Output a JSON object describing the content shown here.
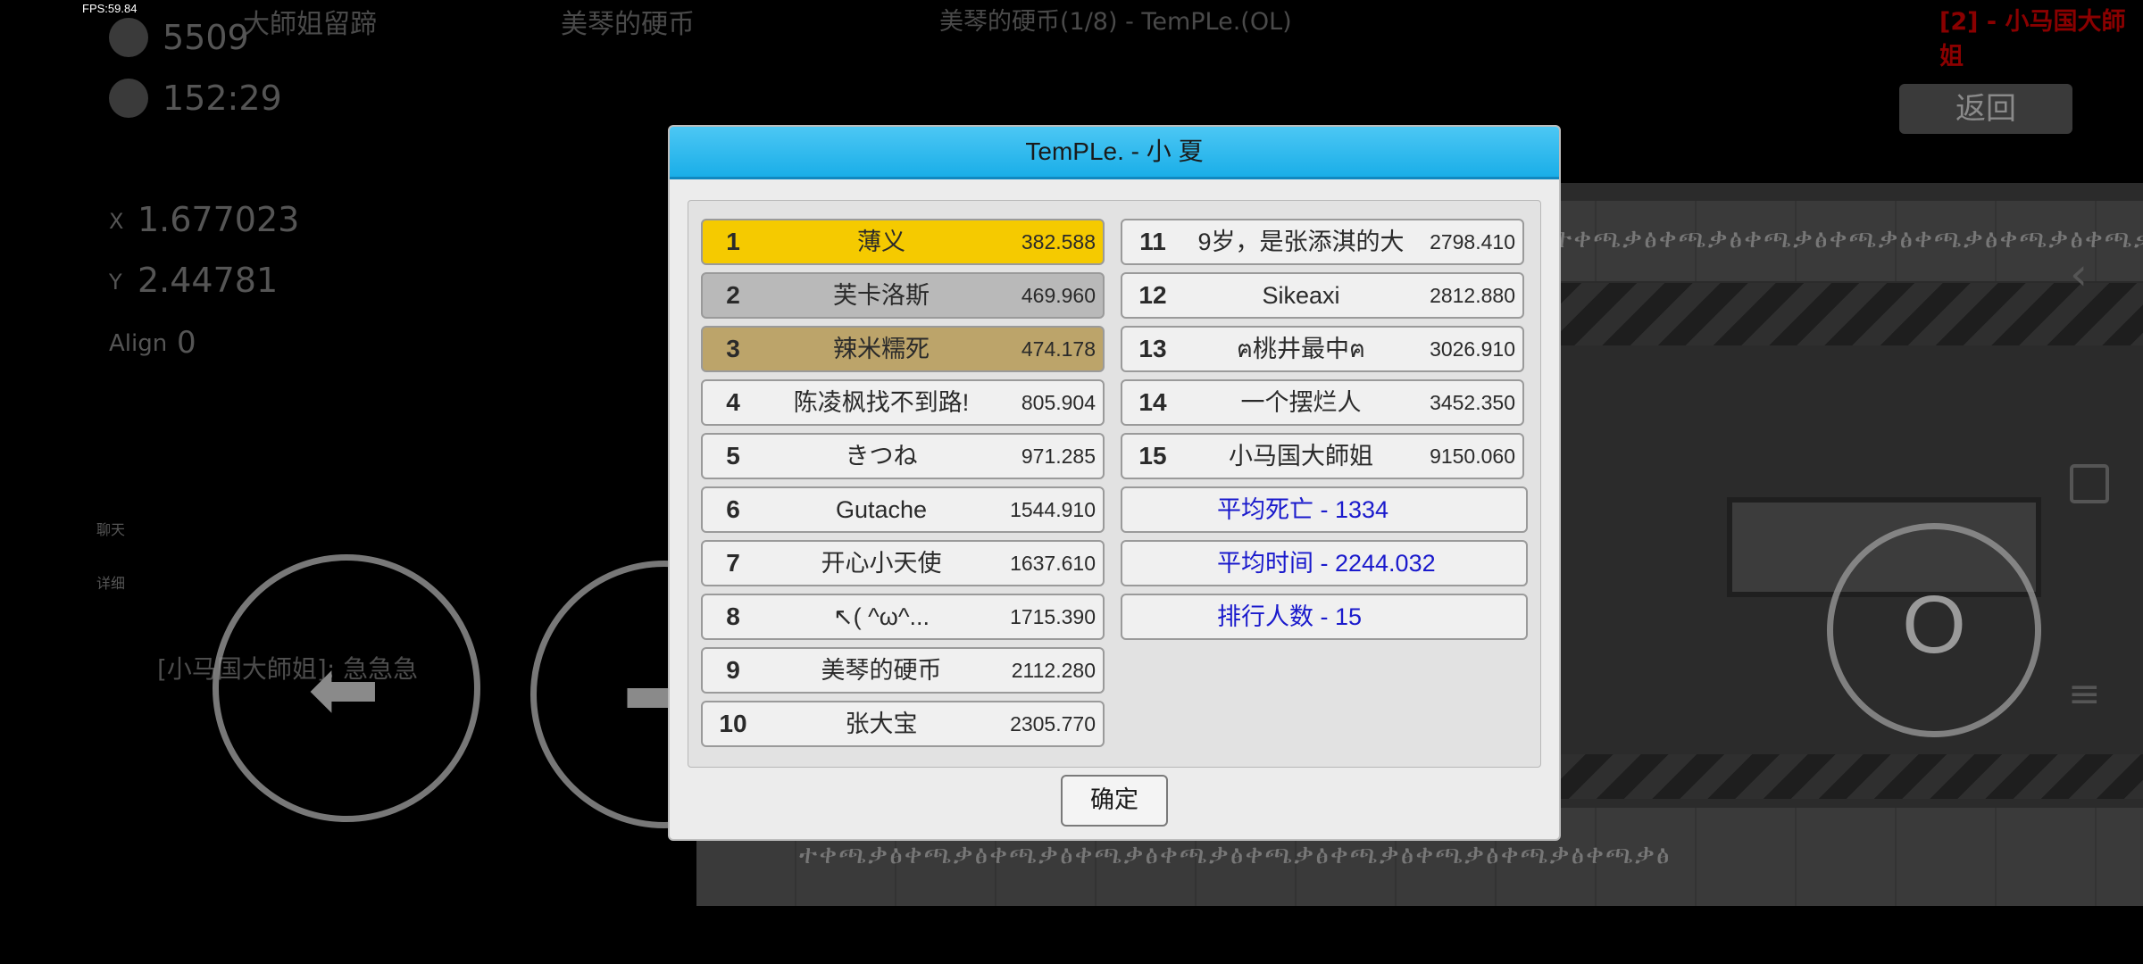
{
  "fps": "FPS:59.84",
  "top_bar": {
    "left_title": "大師姐留蹄",
    "level_name": "美琴的硬币",
    "progress": "美琴的硬币(1/8) - TemPLe.(OL)",
    "player_tag": "[2] - 小马国大師姐"
  },
  "hud": {
    "deaths": "5509",
    "time": "152:29",
    "x_label": "X",
    "x_value": "1.677023",
    "y_label": "Y",
    "y_value": "2.44781",
    "align_label": "Align",
    "align_value": "0",
    "chat_label": "聊天",
    "detail_label": "详细",
    "chat_message": "[小马国大師姐]: 急急急",
    "back_label": "返回",
    "jump_label": "O"
  },
  "glyph_text": "ተቀጫቃፅቀጫቃፅቀጫቃፅቀጫቃፅቀጫቃፅቀጫቃፅቀጫቃፅቀጫቃፅቀጫቃፅቀጫቃፅ",
  "dialog": {
    "title": "TemPLe. - 小 夏",
    "ok_label": "确定",
    "leaderboard_left": [
      {
        "rank": "1",
        "name": "薄义",
        "score": "382.588",
        "style": "gold"
      },
      {
        "rank": "2",
        "name": "芙卡洛斯",
        "score": "469.960",
        "style": "silver"
      },
      {
        "rank": "3",
        "name": "辣米糯死",
        "score": "474.178",
        "style": "bronze"
      },
      {
        "rank": "4",
        "name": "陈凌枫找不到路!",
        "score": "805.904",
        "style": "plain"
      },
      {
        "rank": "5",
        "name": "きつね",
        "score": "971.285",
        "style": "plain"
      },
      {
        "rank": "6",
        "name": "Gutache",
        "score": "1544.910",
        "style": "plain"
      },
      {
        "rank": "7",
        "name": "开心小天使",
        "score": "1637.610",
        "style": "plain"
      },
      {
        "rank": "8",
        "name": "↖( ^ω^...",
        "score": "1715.390",
        "style": "plain"
      },
      {
        "rank": "9",
        "name": "美琴的硬币",
        "score": "2112.280",
        "style": "plain"
      },
      {
        "rank": "10",
        "name": "张大宝",
        "score": "2305.770",
        "style": "plain"
      }
    ],
    "leaderboard_right": [
      {
        "rank": "11",
        "name": "9岁，是张添淇的大",
        "score": "2798.410",
        "style": "plain"
      },
      {
        "rank": "12",
        "name": "Sikeaxi",
        "score": "2812.880",
        "style": "plain"
      },
      {
        "rank": "13",
        "name": "ฅ桃井最中ฅ",
        "score": "3026.910",
        "style": "plain"
      },
      {
        "rank": "14",
        "name": "一个摆烂人",
        "score": "3452.350",
        "style": "plain"
      },
      {
        "rank": "15",
        "name": "小马国大師姐",
        "score": "9150.060",
        "style": "plain"
      }
    ],
    "stats": [
      "平均死亡 - 1334",
      "平均时间 - 2244.032",
      "排行人数 - 15"
    ]
  }
}
